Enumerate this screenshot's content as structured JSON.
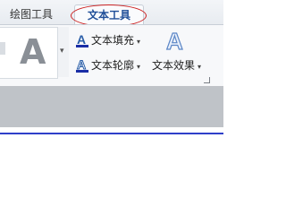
{
  "tabs": {
    "drawing_tools": "绘图工具",
    "text_tools": "文本工具",
    "active": "text_tools"
  },
  "ribbon": {
    "gallery_sample": "A",
    "text_fill": {
      "icon": "text-fill-icon",
      "label": "文本填充",
      "icon_letter": "A"
    },
    "text_outline": {
      "icon": "text-outline-icon",
      "label": "文本轮廓",
      "icon_letter": "A"
    },
    "text_effects": {
      "icon": "text-effects-icon",
      "label": "文本效果",
      "icon_letter": "A"
    },
    "dropdown_glyph": "▾",
    "gallery_more_glyph": "▾"
  },
  "colors": {
    "accent": "#1f4e98",
    "highlight_ellipse": "#cc2222",
    "document_border": "#2f3fc9"
  }
}
